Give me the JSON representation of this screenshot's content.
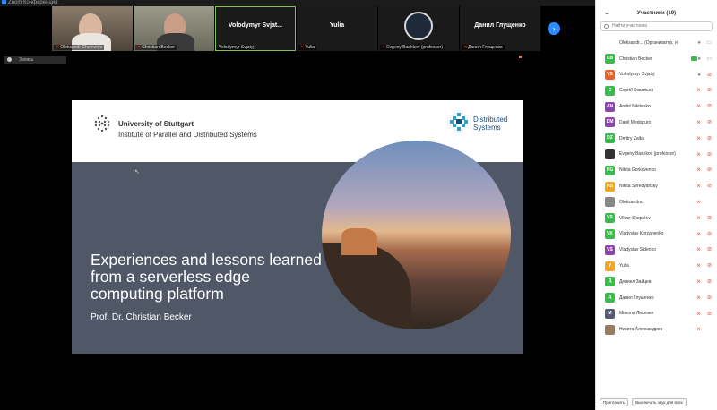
{
  "window": {
    "title": "Zoom Конференция"
  },
  "thumbnails": [
    {
      "name": "Oleksandr Chemeryz",
      "muted": true,
      "kind": "video"
    },
    {
      "name": "Christian Becker",
      "muted": true,
      "kind": "video"
    },
    {
      "name": "Volodymyr Svjat...",
      "caption": "Volodymyr Svjatyj",
      "muted": false,
      "kind": "name",
      "active": true
    },
    {
      "name": "Yulia",
      "caption": "Yulia",
      "muted": true,
      "kind": "name"
    },
    {
      "name": "Evgeny Bashkov (professor)",
      "muted": true,
      "kind": "logo"
    },
    {
      "name": "Данил Глущенко",
      "caption": "Данил Глущенко",
      "muted": true,
      "kind": "name"
    }
  ],
  "mini_tile": {
    "label": "Запись"
  },
  "slide": {
    "university": "University of Stuttgart",
    "institute": "Institute of Parallel and Distributed Systems",
    "group_line1": "Distributed",
    "group_line2": "Systems",
    "title": "Experiences and lessons learned from a serverless edge computing platform",
    "author": "Prof. Dr. Christian Becker"
  },
  "panel": {
    "title": "Участники (19)",
    "search_placeholder": "Найти участника",
    "participants": [
      {
        "initials": "",
        "color": "#ffffff",
        "name": "Oleksandr... (Организатор, я)",
        "mic": "on",
        "cam": "on"
      },
      {
        "initials": "CB",
        "color": "#3bbb4c",
        "name": "Christian Becker",
        "mic": "on",
        "cam": "on",
        "sharing": true
      },
      {
        "initials": "VS",
        "color": "#e8632b",
        "name": "Volodymyr Svjatyj",
        "mic": "on",
        "cam": "off"
      },
      {
        "initials": "С",
        "color": "#3bbb4c",
        "name": "Сергій Ковальов",
        "mic": "off",
        "cam": "off"
      },
      {
        "initials": "AN",
        "color": "#8e44ad",
        "name": "Andrii Nikitenko",
        "mic": "off",
        "cam": "off"
      },
      {
        "initials": "DM",
        "color": "#8e44ad",
        "name": "Danil Medopuro",
        "mic": "off",
        "cam": "off"
      },
      {
        "initials": "DZ",
        "color": "#3bbb4c",
        "name": "Dmitry Zaiba",
        "mic": "off",
        "cam": "off"
      },
      {
        "initials": "",
        "color": "#333333",
        "name": "Evgeny Bashkov (professor)",
        "mic": "off",
        "cam": "off"
      },
      {
        "initials": "NG",
        "color": "#3bbb4c",
        "name": "Nikita Gorkovenko",
        "mic": "off",
        "cam": "off"
      },
      {
        "initials": "NS",
        "color": "#f5a623",
        "name": "Nikita Seredyansky",
        "mic": "off",
        "cam": "off"
      },
      {
        "initials": "",
        "color": "#888888",
        "name": "Oleksandra",
        "mic": "off",
        "cam": "none"
      },
      {
        "initials": "VS",
        "color": "#3bbb4c",
        "name": "Viktor Skopalov",
        "mic": "off",
        "cam": "off"
      },
      {
        "initials": "VK",
        "color": "#3bbb4c",
        "name": "Vladyslav Korzanenko",
        "mic": "off",
        "cam": "off"
      },
      {
        "initials": "VS",
        "color": "#8e44ad",
        "name": "Vladyslav Sidenko",
        "mic": "off",
        "cam": "off"
      },
      {
        "initials": "Y",
        "color": "#f5a623",
        "name": "Yulia",
        "mic": "off",
        "cam": "off"
      },
      {
        "initials": "Д",
        "color": "#3bbb4c",
        "name": "Дениел Зайцев",
        "mic": "off",
        "cam": "off"
      },
      {
        "initials": "Д",
        "color": "#3bbb4c",
        "name": "Данил Глущенко",
        "mic": "off",
        "cam": "off"
      },
      {
        "initials": "М",
        "color": "#555b75",
        "name": "Микола Лисенко",
        "mic": "off",
        "cam": "off"
      },
      {
        "initials": "",
        "color": "#9a7b5a",
        "name": "Никита Александров",
        "mic": "off",
        "cam": "none"
      }
    ],
    "invite_label": "Пригласить",
    "mute_all_label": "Выключить звук для всех"
  },
  "colors": {
    "accent": "#2d8cff",
    "muted": "#e0362c",
    "slide_bg": "#505767"
  }
}
